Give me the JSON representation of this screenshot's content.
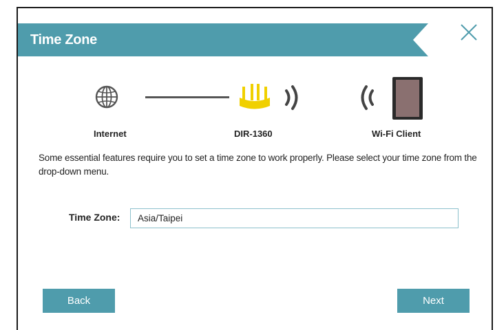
{
  "dialog": {
    "title": "Time Zone",
    "close_icon": "close-icon"
  },
  "topology": {
    "internet_label": "Internet",
    "router_label": "DIR-1360",
    "client_label": "Wi-Fi Client",
    "icons": [
      "globe-icon",
      "router-icon",
      "wifi-signal-icon",
      "tablet-icon"
    ],
    "router_color": "#f0d000"
  },
  "description": "Some essential features require you to set a time zone to work properly. Please select your time zone from the drop-down menu.",
  "form": {
    "time_zone_label": "Time Zone:",
    "time_zone_value": "Asia/Taipei"
  },
  "buttons": {
    "back_label": "Back",
    "next_label": "Next"
  },
  "colors": {
    "accent": "#4f9cac",
    "input_border": "#8cc0cc"
  }
}
